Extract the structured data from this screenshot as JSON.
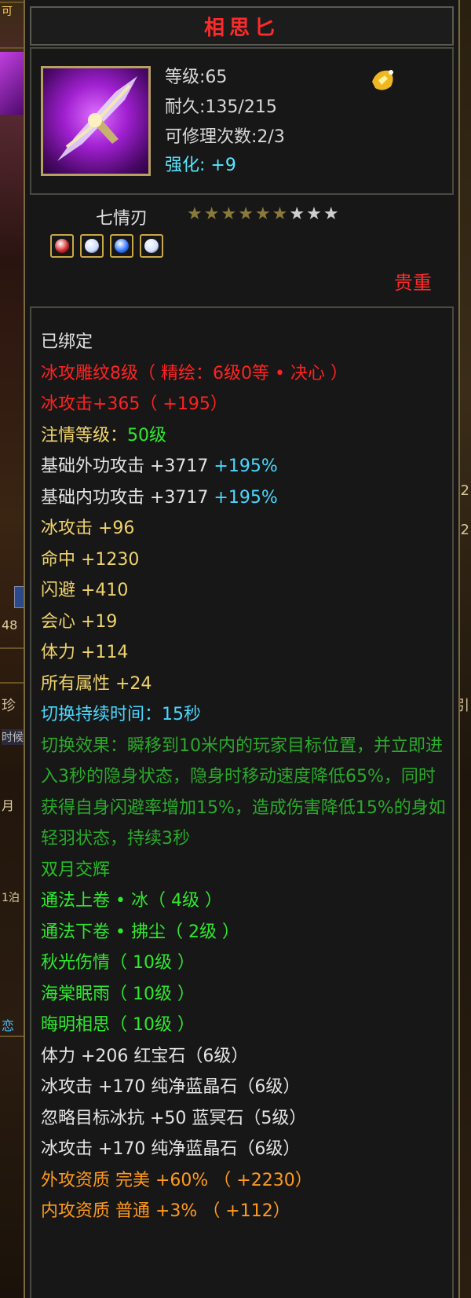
{
  "background": {
    "left_labels": [
      "可",
      "48",
      "珍",
      "时候",
      "月",
      "1泊",
      "恋"
    ],
    "right_labels": [
      "2",
      "2",
      "引"
    ]
  },
  "tooltip": {
    "title": "相思匕",
    "header": {
      "level_label": "等级",
      "level_value": ":65",
      "durability_label": "耐久",
      "durability_value": ":135/215",
      "repair_label": "可修理次数",
      "repair_value": ":2/3",
      "enhance_label": "强化:",
      "enhance_value": "+9"
    },
    "weapon_type": "七情刃",
    "stars": {
      "filled": 6,
      "total": 9
    },
    "gems": [
      {
        "name": "red-gem-icon",
        "color": "#d02020"
      },
      {
        "name": "white-gem-icon",
        "color": "#c8d8ff"
      },
      {
        "name": "blue-gem-icon",
        "color": "#2a70ff"
      },
      {
        "name": "white-gem-icon",
        "color": "#d0e0ff"
      }
    ],
    "rarity": "贵重",
    "lines": [
      {
        "text": "已绑定",
        "color": "white"
      },
      {
        "text": "冰攻雕纹8级（ 精绘：6级0等 • 决心 ）",
        "color": "red"
      },
      {
        "text": "冰攻击+365（ +195）",
        "color": "red"
      },
      {
        "text": "注情等级：",
        "suffix": "50级",
        "color": "yellow",
        "suffix_color": "lgreen"
      },
      {
        "text": "基础外功攻击  +3717  ",
        "suffix": "+195%",
        "color": "white",
        "suffix_color": "cyan"
      },
      {
        "text": "基础内功攻击  +3717  ",
        "suffix": "+195%",
        "color": "white",
        "suffix_color": "cyan"
      },
      {
        "text": "冰攻击  +96",
        "color": "yellow"
      },
      {
        "text": "命中  +1230",
        "color": "yellow"
      },
      {
        "text": "闪避  +410",
        "color": "yellow"
      },
      {
        "text": "会心  +19",
        "color": "yellow"
      },
      {
        "text": "体力  +114",
        "color": "yellow"
      },
      {
        "text": "所有属性  +24",
        "color": "yellow"
      },
      {
        "text": "切换持续时间：15秒",
        "color": "cyan"
      }
    ],
    "switch_effect": "切换效果：瞬移到10米内的玩家目标位置，并立即进入3秒的隐身状态，隐身时移动速度降低65%，同时获得自身闪避率增加15%，造成伤害降低15%的身如轻羽状态，持续3秒",
    "lines2": [
      {
        "text": "双月交辉",
        "color": "green"
      },
      {
        "text": "通法上卷 • 冰（ 4级 ）",
        "color": "lgreen"
      },
      {
        "text": "通法下卷 • 拂尘（ 2级 ）",
        "color": "lgreen"
      },
      {
        "text": "秋光伤情（ 10级 ）",
        "color": "lgreen"
      },
      {
        "text": "海棠眠雨（ 10级 ）",
        "color": "lgreen"
      },
      {
        "text": "晦明相思（ 10级 ）",
        "color": "lgreen"
      },
      {
        "text": "体力  +206  红宝石（6级）",
        "color": "white"
      },
      {
        "text": "冰攻击  +170  纯净蓝晶石（6级）",
        "color": "white"
      },
      {
        "text": "忽略目标冰抗  +50  蓝冥石（5级）",
        "color": "white"
      },
      {
        "text": "冰攻击  +170  纯净蓝晶石（6级）",
        "color": "white"
      },
      {
        "text": "外攻资质   完美  +60%  （ +2230）",
        "color": "orange"
      },
      {
        "text": "内攻资质   普通  +3%  （ +112）",
        "color": "orange"
      }
    ]
  }
}
